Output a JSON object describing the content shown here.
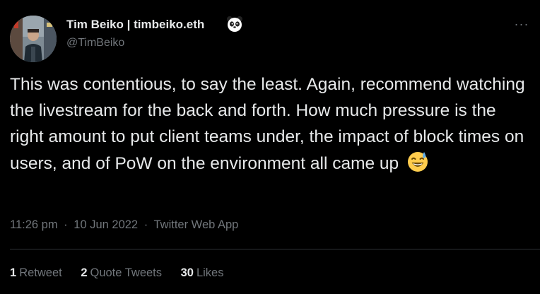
{
  "author": {
    "name": "Tim Beiko | timbeiko.eth",
    "handle": "@TimBeiko",
    "badge_icon": "panda-emoji-icon"
  },
  "menu": {
    "more_label": "···"
  },
  "tweet": {
    "text": "This was contentious, to say the least. Again, recommend watching the livestream for the back and forth. How much pressure is the right amount to put client teams under, the impact of block times on users, and of PoW on the environment all came up",
    "emoji_icon": "grinning-face-with-sweat-emoji-icon"
  },
  "meta": {
    "time": "11:26 pm",
    "date": "10 Jun 2022",
    "source": "Twitter Web App",
    "separator": "·"
  },
  "stats": {
    "retweets": {
      "count": "1",
      "label": "Retweet"
    },
    "quote_tweets": {
      "count": "2",
      "label": "Quote Tweets"
    },
    "likes": {
      "count": "30",
      "label": "Likes"
    }
  },
  "colors": {
    "background": "#000000",
    "primary_text": "#e7e9ea",
    "secondary_text": "#71767b",
    "divider": "#2f3336"
  }
}
